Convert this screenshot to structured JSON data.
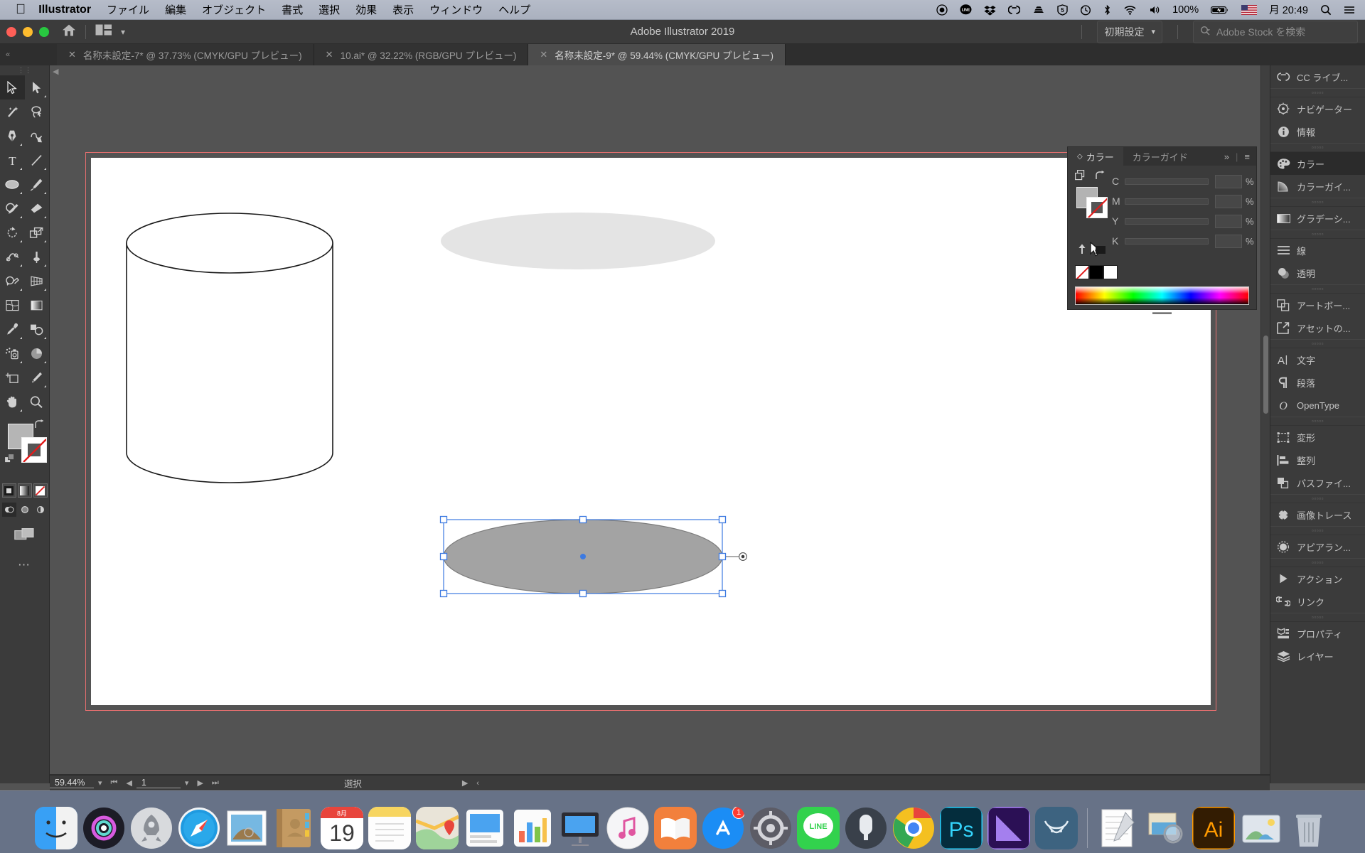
{
  "macbar": {
    "apple": "apple-logo",
    "app": "Illustrator",
    "menus": [
      "ファイル",
      "編集",
      "オブジェクト",
      "書式",
      "選択",
      "効果",
      "表示",
      "ウィンドウ",
      "ヘルプ"
    ],
    "status_icons": [
      "record-icon",
      "line-icon",
      "dropbox-icon",
      "creative-cloud-icon",
      "backup-icon",
      "security-icon",
      "timemachine-icon",
      "bluetooth-icon",
      "wifi-icon",
      "volume-icon"
    ],
    "battery_percent": "100%",
    "input_source": "US-flag",
    "clock": "月 20:49",
    "spotlight": "search-icon",
    "control_center": "menu-icon"
  },
  "titlebar": {
    "title": "Adobe Illustrator 2019",
    "home": "home-icon",
    "arrange": "arrange-documents-icon",
    "workspace": "初期設定",
    "stock_placeholder": "Adobe Stock を検索"
  },
  "tabs": [
    {
      "label": "名称未設定-7* @ 37.73% (CMYK/GPU プレビュー)",
      "active": false
    },
    {
      "label": "10.ai* @ 32.22% (RGB/GPU プレビュー)",
      "active": false
    },
    {
      "label": "名称未設定-9* @ 59.44% (CMYK/GPU プレビュー)",
      "active": true
    }
  ],
  "toolbar": {
    "tools": [
      {
        "name": "selection-tool",
        "glyph": "selection",
        "selected": true,
        "corner": false
      },
      {
        "name": "direct-selection-tool",
        "glyph": "direct",
        "selected": false,
        "corner": true
      },
      {
        "name": "magic-wand-tool",
        "glyph": "wand",
        "selected": false,
        "corner": false
      },
      {
        "name": "lasso-tool",
        "glyph": "lasso",
        "selected": false,
        "corner": false
      },
      {
        "name": "pen-tool",
        "glyph": "pen",
        "selected": false,
        "corner": true
      },
      {
        "name": "curvature-tool",
        "glyph": "curvature",
        "selected": false,
        "corner": false
      },
      {
        "name": "type-tool",
        "glyph": "type",
        "selected": false,
        "corner": true
      },
      {
        "name": "line-segment-tool",
        "glyph": "line",
        "selected": false,
        "corner": true
      },
      {
        "name": "ellipse-tool",
        "glyph": "ellipse",
        "selected": false,
        "corner": true
      },
      {
        "name": "paintbrush-tool",
        "glyph": "brush",
        "selected": false,
        "corner": true
      },
      {
        "name": "shaper-tool",
        "glyph": "shaper",
        "selected": false,
        "corner": true
      },
      {
        "name": "eraser-tool",
        "glyph": "eraser",
        "selected": false,
        "corner": true
      },
      {
        "name": "rotate-tool",
        "glyph": "rotate",
        "selected": false,
        "corner": true
      },
      {
        "name": "scale-tool",
        "glyph": "scale",
        "selected": false,
        "corner": true
      },
      {
        "name": "width-tool",
        "glyph": "width",
        "selected": false,
        "corner": true
      },
      {
        "name": "free-transform-tool",
        "glyph": "pushpin",
        "selected": false,
        "corner": true
      },
      {
        "name": "shape-builder-tool",
        "glyph": "shapebuilder",
        "selected": false,
        "corner": true
      },
      {
        "name": "perspective-grid-tool",
        "glyph": "perspective",
        "selected": false,
        "corner": true
      },
      {
        "name": "mesh-tool",
        "glyph": "mesh",
        "selected": false,
        "corner": false
      },
      {
        "name": "gradient-tool",
        "glyph": "gradient",
        "selected": false,
        "corner": false
      },
      {
        "name": "eyedropper-tool",
        "glyph": "eyedropper",
        "selected": false,
        "corner": true
      },
      {
        "name": "blend-tool",
        "glyph": "blend",
        "selected": false,
        "corner": true
      },
      {
        "name": "symbol-sprayer-tool",
        "glyph": "sprayer",
        "selected": false,
        "corner": true
      },
      {
        "name": "column-graph-tool",
        "glyph": "graph",
        "selected": false,
        "corner": true
      },
      {
        "name": "artboard-tool",
        "glyph": "artboard",
        "selected": false,
        "corner": false
      },
      {
        "name": "slice-tool",
        "glyph": "slice",
        "selected": false,
        "corner": true
      },
      {
        "name": "hand-tool",
        "glyph": "hand",
        "selected": false,
        "corner": true
      },
      {
        "name": "zoom-tool",
        "glyph": "zoom",
        "selected": false,
        "corner": false
      }
    ],
    "fill_color": "#b5b5b5",
    "stroke_color": "#555555",
    "mode_buttons": [
      "color-mode",
      "gradient-mode",
      "none-mode"
    ],
    "draw_buttons": [
      "draw-normal",
      "draw-behind",
      "draw-inside"
    ],
    "screen_mode": "screen-mode-icon",
    "more_tools": "..."
  },
  "color_panel": {
    "tabs": [
      {
        "label": "カラー",
        "active": true
      },
      {
        "label": "カラーガイド",
        "active": false
      }
    ],
    "expand": "»",
    "menu": "≡",
    "channels": [
      {
        "label": "C",
        "value": "",
        "unit": "%"
      },
      {
        "label": "M",
        "value": "",
        "unit": "%"
      },
      {
        "label": "Y",
        "value": "",
        "unit": "%"
      },
      {
        "label": "K",
        "value": "",
        "unit": "%"
      }
    ],
    "fill_color": "#b3b3b3",
    "stroke_color": "#ffffff",
    "swatches": [
      "none-swatch",
      "black-swatch",
      "white-swatch"
    ],
    "spectrum": "color-spectrum-bar"
  },
  "right_dock": {
    "groups": [
      {
        "grip": false,
        "items": [
          {
            "label": "CC ライブ...",
            "icon": "creative-cloud-icon",
            "active": false
          }
        ]
      },
      {
        "grip": true,
        "items": [
          {
            "label": "ナビゲーター",
            "icon": "navigator-icon",
            "active": false
          },
          {
            "label": "情報",
            "icon": "info-icon",
            "active": false
          }
        ]
      },
      {
        "grip": true,
        "items": [
          {
            "label": "カラー",
            "icon": "color-palette-icon",
            "active": true
          },
          {
            "label": "カラーガイ...",
            "icon": "color-guide-icon",
            "active": false
          }
        ]
      },
      {
        "grip": true,
        "items": [
          {
            "label": "グラデーシ...",
            "icon": "gradient-icon",
            "active": false
          }
        ]
      },
      {
        "grip": true,
        "items": [
          {
            "label": "線",
            "icon": "stroke-icon",
            "active": false
          },
          {
            "label": "透明",
            "icon": "transparency-icon",
            "active": false
          }
        ]
      },
      {
        "grip": true,
        "items": [
          {
            "label": "アートボー...",
            "icon": "artboards-icon",
            "active": false
          },
          {
            "label": "アセットの...",
            "icon": "asset-export-icon",
            "active": false
          }
        ]
      },
      {
        "grip": true,
        "items": [
          {
            "label": "文字",
            "icon": "character-icon",
            "active": false
          },
          {
            "label": "段落",
            "icon": "paragraph-icon",
            "active": false
          },
          {
            "label": "OpenType",
            "icon": "opentype-icon",
            "active": false
          }
        ]
      },
      {
        "grip": true,
        "items": [
          {
            "label": "変形",
            "icon": "transform-icon",
            "active": false
          },
          {
            "label": "整列",
            "icon": "align-icon",
            "active": false
          },
          {
            "label": "パスファイ...",
            "icon": "pathfinder-icon",
            "active": false
          }
        ]
      },
      {
        "grip": true,
        "items": [
          {
            "label": "画像トレース",
            "icon": "image-trace-icon",
            "active": false
          }
        ]
      },
      {
        "grip": true,
        "items": [
          {
            "label": "アピアラン...",
            "icon": "appearance-icon",
            "active": false
          }
        ]
      },
      {
        "grip": true,
        "items": [
          {
            "label": "アクション",
            "icon": "actions-icon",
            "active": false
          },
          {
            "label": "リンク",
            "icon": "links-icon",
            "active": false
          }
        ]
      },
      {
        "grip": true,
        "items": [
          {
            "label": "プロパティ",
            "icon": "properties-icon",
            "active": false
          },
          {
            "label": "レイヤー",
            "icon": "layers-icon",
            "active": false
          }
        ]
      }
    ]
  },
  "canvas": {
    "shapes": [
      {
        "name": "cylinder-shape",
        "type": "cylinder",
        "fill": "#ffffff",
        "stroke": "#1a1a1a"
      },
      {
        "name": "light-gray-ellipse",
        "type": "ellipse",
        "fill": "#e4e4e4",
        "stroke": "none"
      },
      {
        "name": "selected-gray-ellipse",
        "type": "ellipse",
        "fill": "#a3a3a3",
        "stroke": "#7c7c7c",
        "selected": true
      }
    ],
    "selection_color": "#3d7ae1",
    "artboard_border_color": "#e46f6f",
    "cursor": "arrow-cursor"
  },
  "status_bar": {
    "zoom": "59.44%",
    "page": "1",
    "tool_status": "選択",
    "first_icon": "first-page-icon",
    "prev_icon": "prev-page-icon",
    "next_icon": "next-page-icon",
    "last_icon": "last-page-icon"
  },
  "dock": {
    "apps": [
      {
        "name": "finder",
        "label": "Finder",
        "running": true
      },
      {
        "name": "siri",
        "label": "Siri",
        "running": false
      },
      {
        "name": "launchpad",
        "label": "Launchpad",
        "running": false
      },
      {
        "name": "safari",
        "label": "Safari",
        "running": false
      },
      {
        "name": "mail",
        "label": "Mail",
        "running": false
      },
      {
        "name": "contacts",
        "label": "連絡先",
        "running": false
      },
      {
        "name": "calendar",
        "label": "カレンダー",
        "running": false,
        "month": "8月",
        "day": "19"
      },
      {
        "name": "notes",
        "label": "メモ",
        "running": false
      },
      {
        "name": "maps",
        "label": "マップ",
        "running": false
      },
      {
        "name": "keynote-doc",
        "label": "Keynote",
        "running": false
      },
      {
        "name": "numbers",
        "label": "Numbers",
        "running": true
      },
      {
        "name": "keynote",
        "label": "Keynote",
        "running": false
      },
      {
        "name": "itunes",
        "label": "iTunes",
        "running": false
      },
      {
        "name": "ibooks",
        "label": "ブック",
        "running": false
      },
      {
        "name": "appstore",
        "label": "App Store",
        "running": false,
        "badge": "1"
      },
      {
        "name": "system-preferences",
        "label": "システム環境設定",
        "running": false
      },
      {
        "name": "line",
        "label": "LINE",
        "running": false
      },
      {
        "name": "alfred",
        "label": "Alfred",
        "running": false
      },
      {
        "name": "chrome",
        "label": "Google Chrome",
        "running": true
      },
      {
        "name": "photoshop",
        "label": "Photoshop",
        "running": true
      },
      {
        "name": "xd",
        "label": "Adobe XD",
        "running": false
      },
      {
        "name": "bull-app",
        "label": "App",
        "running": false
      },
      {
        "name": "separator",
        "label": "",
        "running": false
      },
      {
        "name": "textedit",
        "label": "テキストエディット",
        "running": true
      },
      {
        "name": "preview",
        "label": "プレビュー",
        "running": true
      },
      {
        "name": "illustrator",
        "label": "Illustrator",
        "running": true
      },
      {
        "name": "photos-folder",
        "label": "ピクチャ",
        "running": false
      },
      {
        "name": "trash",
        "label": "ゴミ箱",
        "running": false
      }
    ]
  }
}
